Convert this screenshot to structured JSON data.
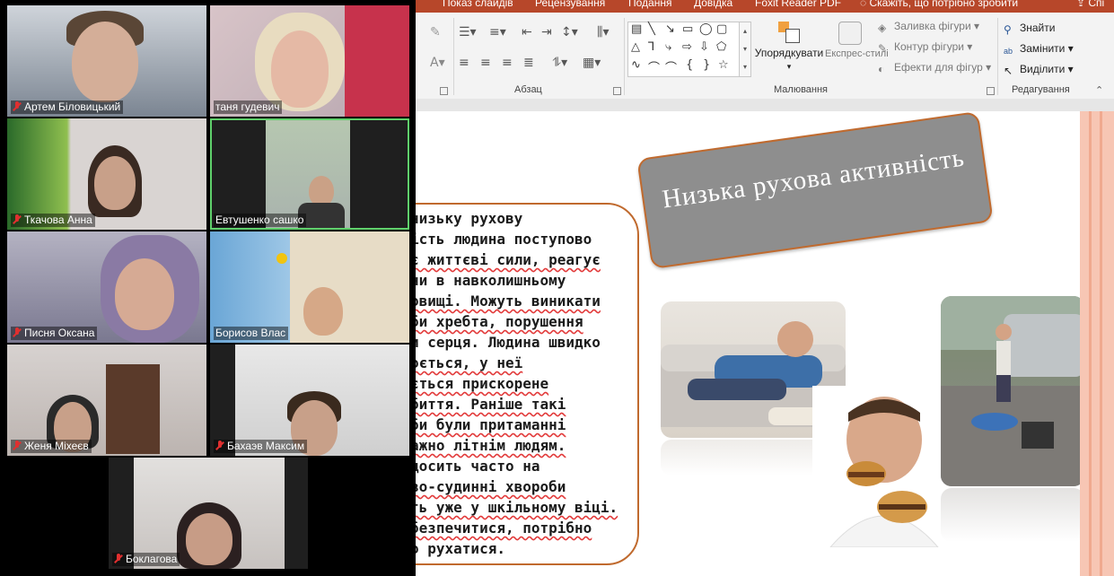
{
  "ribbon": {
    "tabs": [
      "Показ слайдів",
      "Рецензування",
      "Подання",
      "Довідка",
      "Foxit Reader PDF"
    ],
    "tell_me": "Скажіть, що потрібно зробити",
    "share": "Спі",
    "groups": {
      "paragraph": "Абзац",
      "drawing": "Малювання",
      "editing": "Редагування"
    },
    "drawing": {
      "arrange": "Упорядкувати",
      "quick_styles": "Експрес-стилі",
      "shape_fill": "Заливка фігури",
      "shape_outline": "Контур фігури",
      "shape_effects": "Ефекти для фігур"
    },
    "editing": {
      "find": "Знайти",
      "replace": "Замінити",
      "select": "Виділити"
    }
  },
  "slide": {
    "title": "Низька рухова активність",
    "body_lines": [
      "низьку рухову",
      "ість людина поступово",
      "є життєві сили, реагує",
      "ни в навколишньому",
      "овищі. Можуть виникати",
      "би хребта, порушення",
      "и серця. Людина швидко",
      "оється, у неї",
      "ється прискорене",
      "биття. Раніше такі",
      "би були притаманні",
      "ажно літнім людям.",
      "досить часто на",
      "во-судинні хвороби",
      "ть уже у шкільному віці.",
      "безпечитися, потрібно",
      "о рухатися."
    ]
  },
  "participants": [
    {
      "name": "Артем Біловицький",
      "muted": true
    },
    {
      "name": "таня гудевич",
      "muted": false
    },
    {
      "name": "Ткачова Анна",
      "muted": true
    },
    {
      "name": "Евтушенко сашко",
      "muted": false
    },
    {
      "name": "Писня Оксана",
      "muted": true
    },
    {
      "name": "Борисов Влас",
      "muted": false
    },
    {
      "name": "Женя Міхеєв",
      "muted": true
    },
    {
      "name": "Бахаэв Максим",
      "muted": true
    },
    {
      "name": "Боклагова",
      "muted": true
    }
  ],
  "colors": {
    "ribbon_accent": "#b7472a",
    "title_box": "#8e8e8e",
    "border_orange": "#c06a2e",
    "active_speaker": "#5fd06b",
    "muted_icon": "#e02f2f"
  }
}
